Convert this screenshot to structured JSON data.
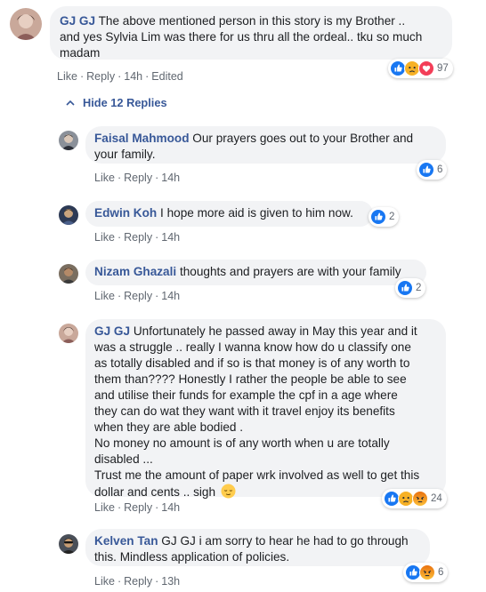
{
  "comments": [
    {
      "author": "GJ GJ",
      "lines": [
        "The above mentioned person in this story is my Brother ..",
        "and yes Sylvia Lim was there for us thru all the ordeal.. tku so much",
        "madam"
      ],
      "actions": {
        "like": "Like",
        "reply": "Reply",
        "time": "14h",
        "edited": "Edited"
      },
      "reactions": {
        "count": "97",
        "types": [
          "like-icon",
          "sad-icon",
          "love-icon"
        ]
      }
    }
  ],
  "hide_replies_label": "Hide 12 Replies",
  "replies": [
    {
      "author": "Faisal Mahmood",
      "lines": [
        "Our prayers goes out to your Brother and",
        "your family."
      ],
      "actions": {
        "like": "Like",
        "reply": "Reply",
        "time": "14h"
      },
      "reactions": {
        "count": "6",
        "types": [
          "like-icon"
        ]
      }
    },
    {
      "author": "Edwin Koh",
      "lines": [
        "I hope more aid is given to him now."
      ],
      "actions": {
        "like": "Like",
        "reply": "Reply",
        "time": "14h"
      },
      "reactions": {
        "count": "2",
        "types": [
          "like-icon"
        ]
      }
    },
    {
      "author": "Nizam Ghazali",
      "lines": [
        "thoughts and prayers are with your family"
      ],
      "actions": {
        "like": "Like",
        "reply": "Reply",
        "time": "14h"
      },
      "reactions": {
        "count": "2",
        "types": [
          "like-icon"
        ]
      }
    },
    {
      "author": "GJ GJ",
      "lines": [
        "Unfortunately he passed away in May this year and it",
        "was a struggle .. really I wanna know how do u classify one",
        "as totally disabled and if so is that money is of any worth to",
        "them than???? Honestly I rather the people be able to see",
        "and utilise their funds for example the cpf in a age where",
        "they can do wat they want with it travel enjoy its benefits",
        "when they are able bodied .",
        "No money no amount is of any worth when u are totally",
        "disabled ...",
        "Trust me the amount of paper wrk involved as well to get this",
        "dollar and cents .. sigh"
      ],
      "emoji": "relieved-face-icon",
      "actions": {
        "like": "Like",
        "reply": "Reply",
        "time": "14h"
      },
      "reactions": {
        "count": "24",
        "types": [
          "like-icon",
          "sad-icon",
          "angry-icon"
        ]
      }
    },
    {
      "author": "Kelven Tan",
      "lines": [
        "GJ GJ i am sorry to hear he had to go through",
        "this. Mindless application of policies."
      ],
      "actions": {
        "like": "Like",
        "reply": "Reply",
        "time": "13h"
      },
      "reactions": {
        "count": "6",
        "types": [
          "like-icon",
          "angry-icon"
        ]
      }
    }
  ],
  "colors": {
    "link": "#385898",
    "bubble": "#f2f3f5",
    "meta": "#606770",
    "like": "#1877f2",
    "love": "#f33e58",
    "haha_sad": "#f7b125",
    "angry": "#e9710f"
  }
}
